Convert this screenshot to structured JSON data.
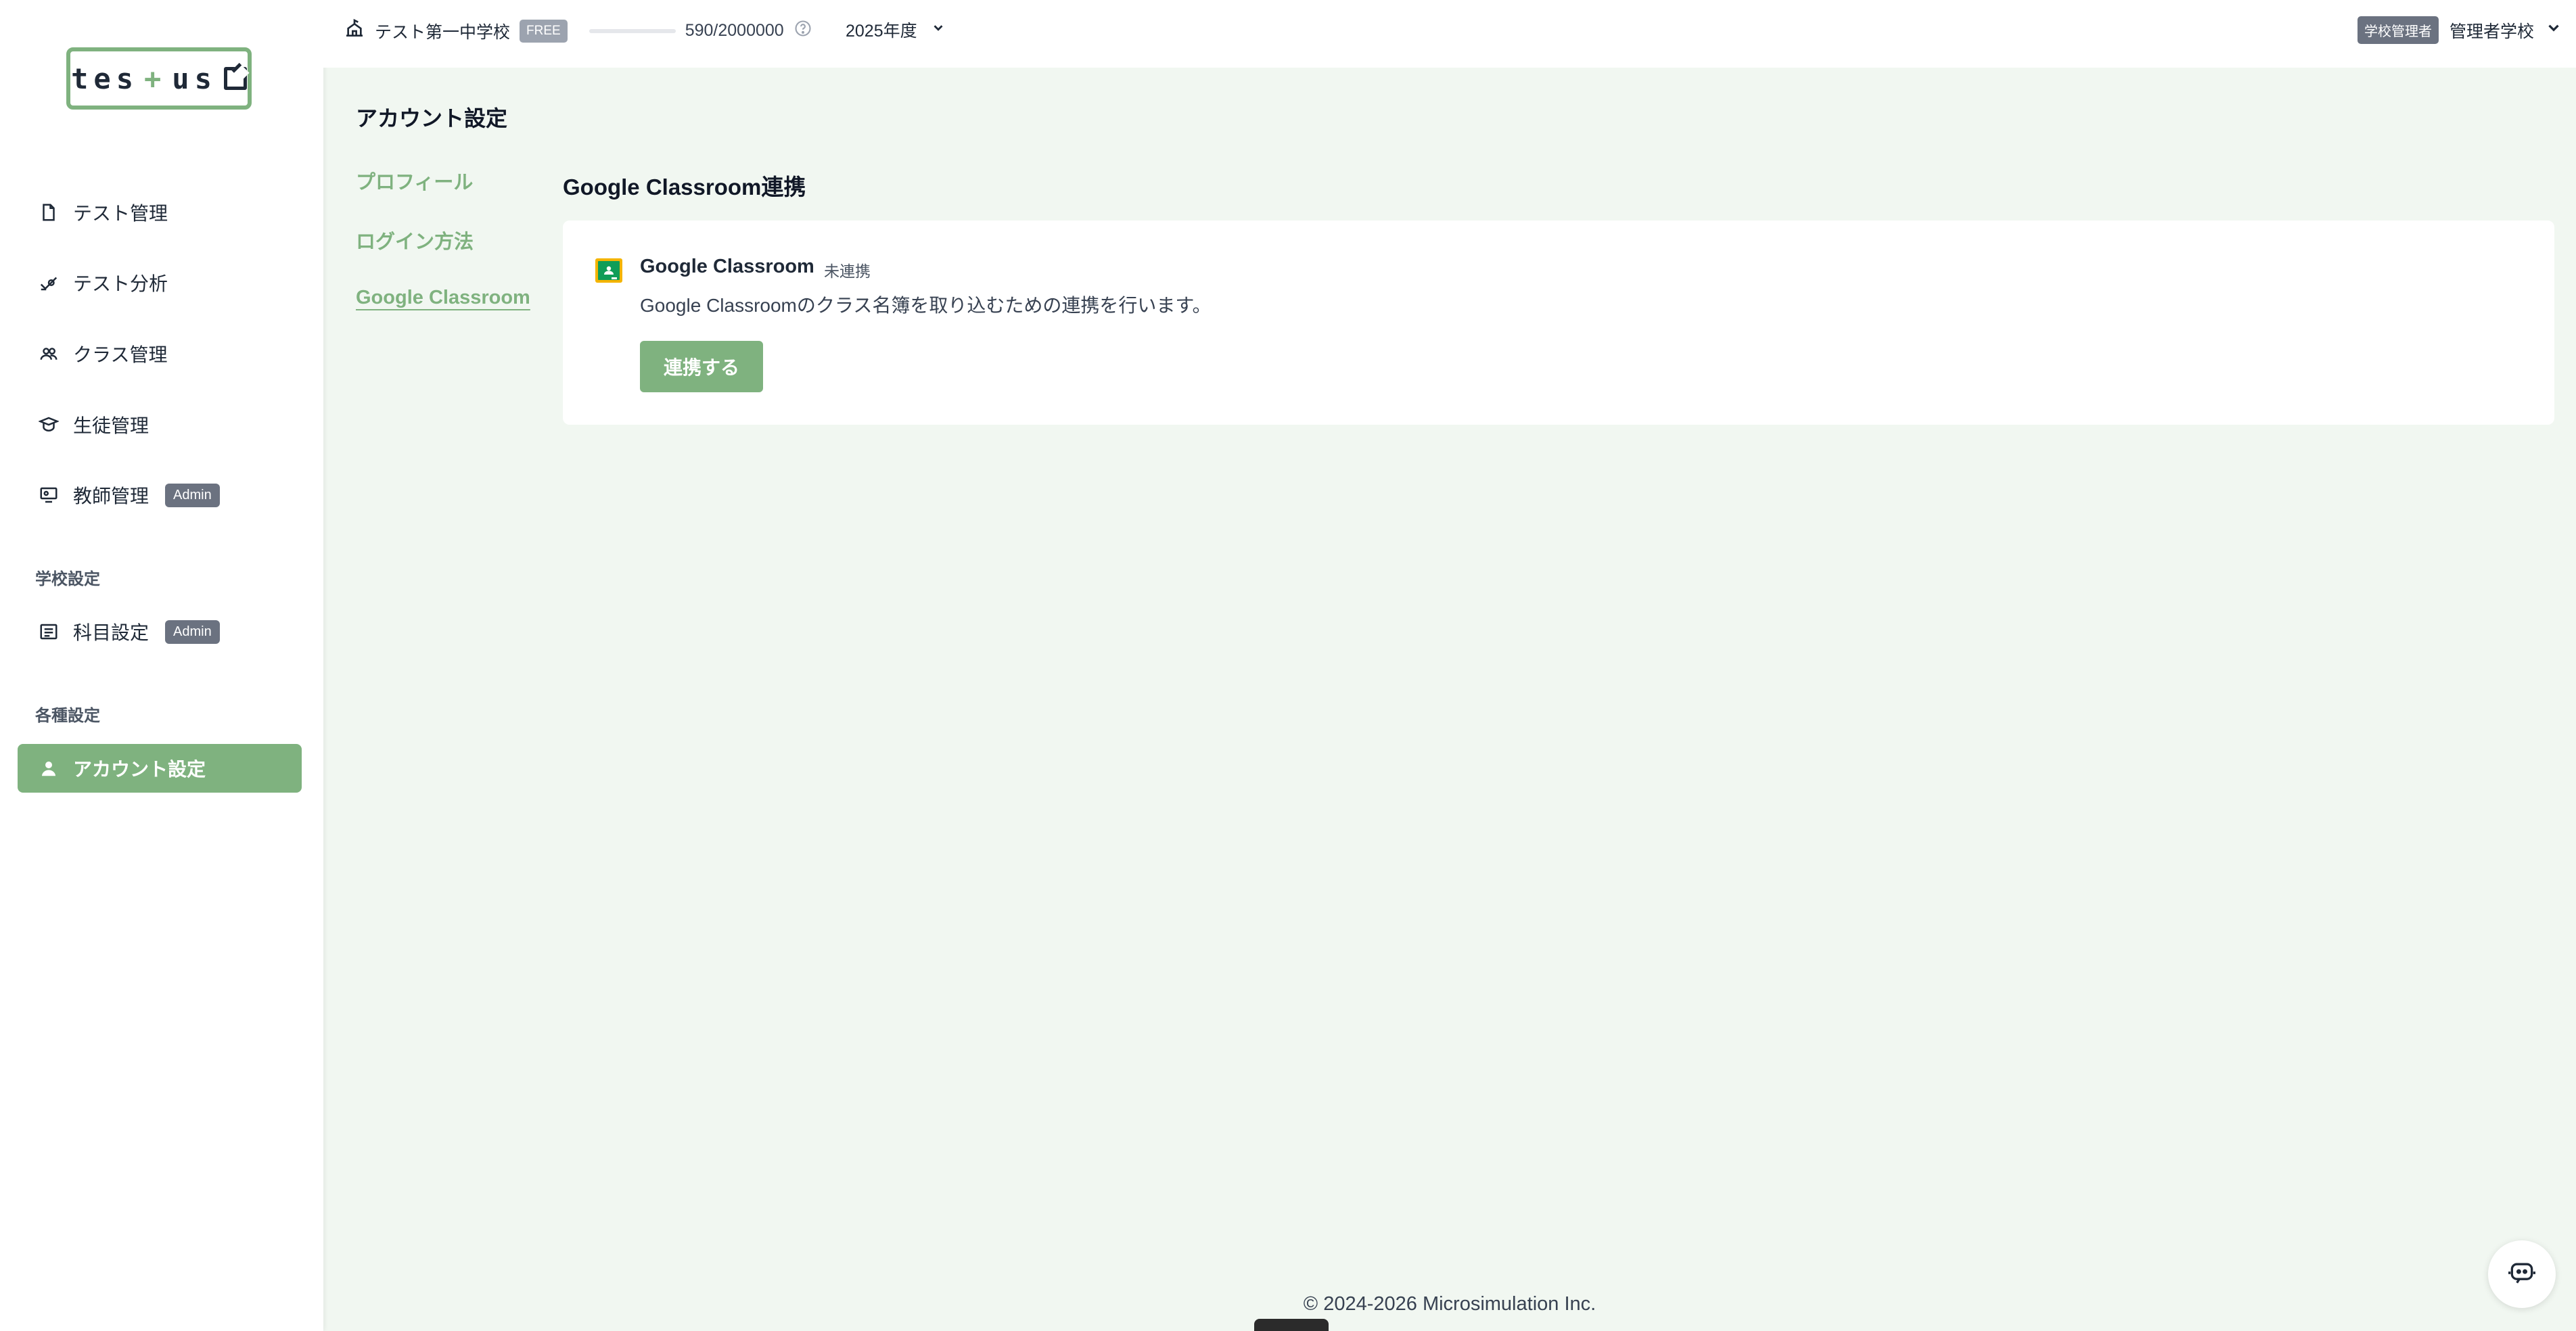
{
  "logo": {
    "left": "tes",
    "plus": "+",
    "right": "us"
  },
  "sidebar": {
    "items": [
      {
        "label": "テスト管理"
      },
      {
        "label": "テスト分析"
      },
      {
        "label": "クラス管理"
      },
      {
        "label": "生徒管理"
      },
      {
        "label": "教師管理",
        "badge": "Admin"
      }
    ],
    "school_section": {
      "label": "学校設定",
      "items": [
        {
          "label": "科目設定",
          "badge": "Admin"
        }
      ]
    },
    "misc_section": {
      "label": "各種設定",
      "items": [
        {
          "label": "アカウント設定",
          "active": true
        }
      ]
    }
  },
  "topbar": {
    "school_name": "テスト第一中学校",
    "plan_badge": "FREE",
    "usage": "590/2000000",
    "usage_fraction": 0.000295,
    "year": "2025年度",
    "role_badge": "学校管理者",
    "user_name": "管理者学校"
  },
  "page": {
    "title": "アカウント設定",
    "subnav": [
      {
        "label": "プロフィール"
      },
      {
        "label": "ログイン方法"
      },
      {
        "label": "Google Classroom",
        "active": true
      }
    ],
    "section_title": "Google Classroom連携",
    "card": {
      "name": "Google Classroom",
      "status": "未連携",
      "description": "Google Classroomのクラス名簿を取り込むための連携を行います。",
      "button_label": "連携する"
    }
  },
  "footer": {
    "copyright": "© 2024-2026 Microsimulation Inc."
  },
  "colors": {
    "accent": "#7fb27f",
    "background": "#f1f7f1",
    "badge": "#6b7280"
  }
}
